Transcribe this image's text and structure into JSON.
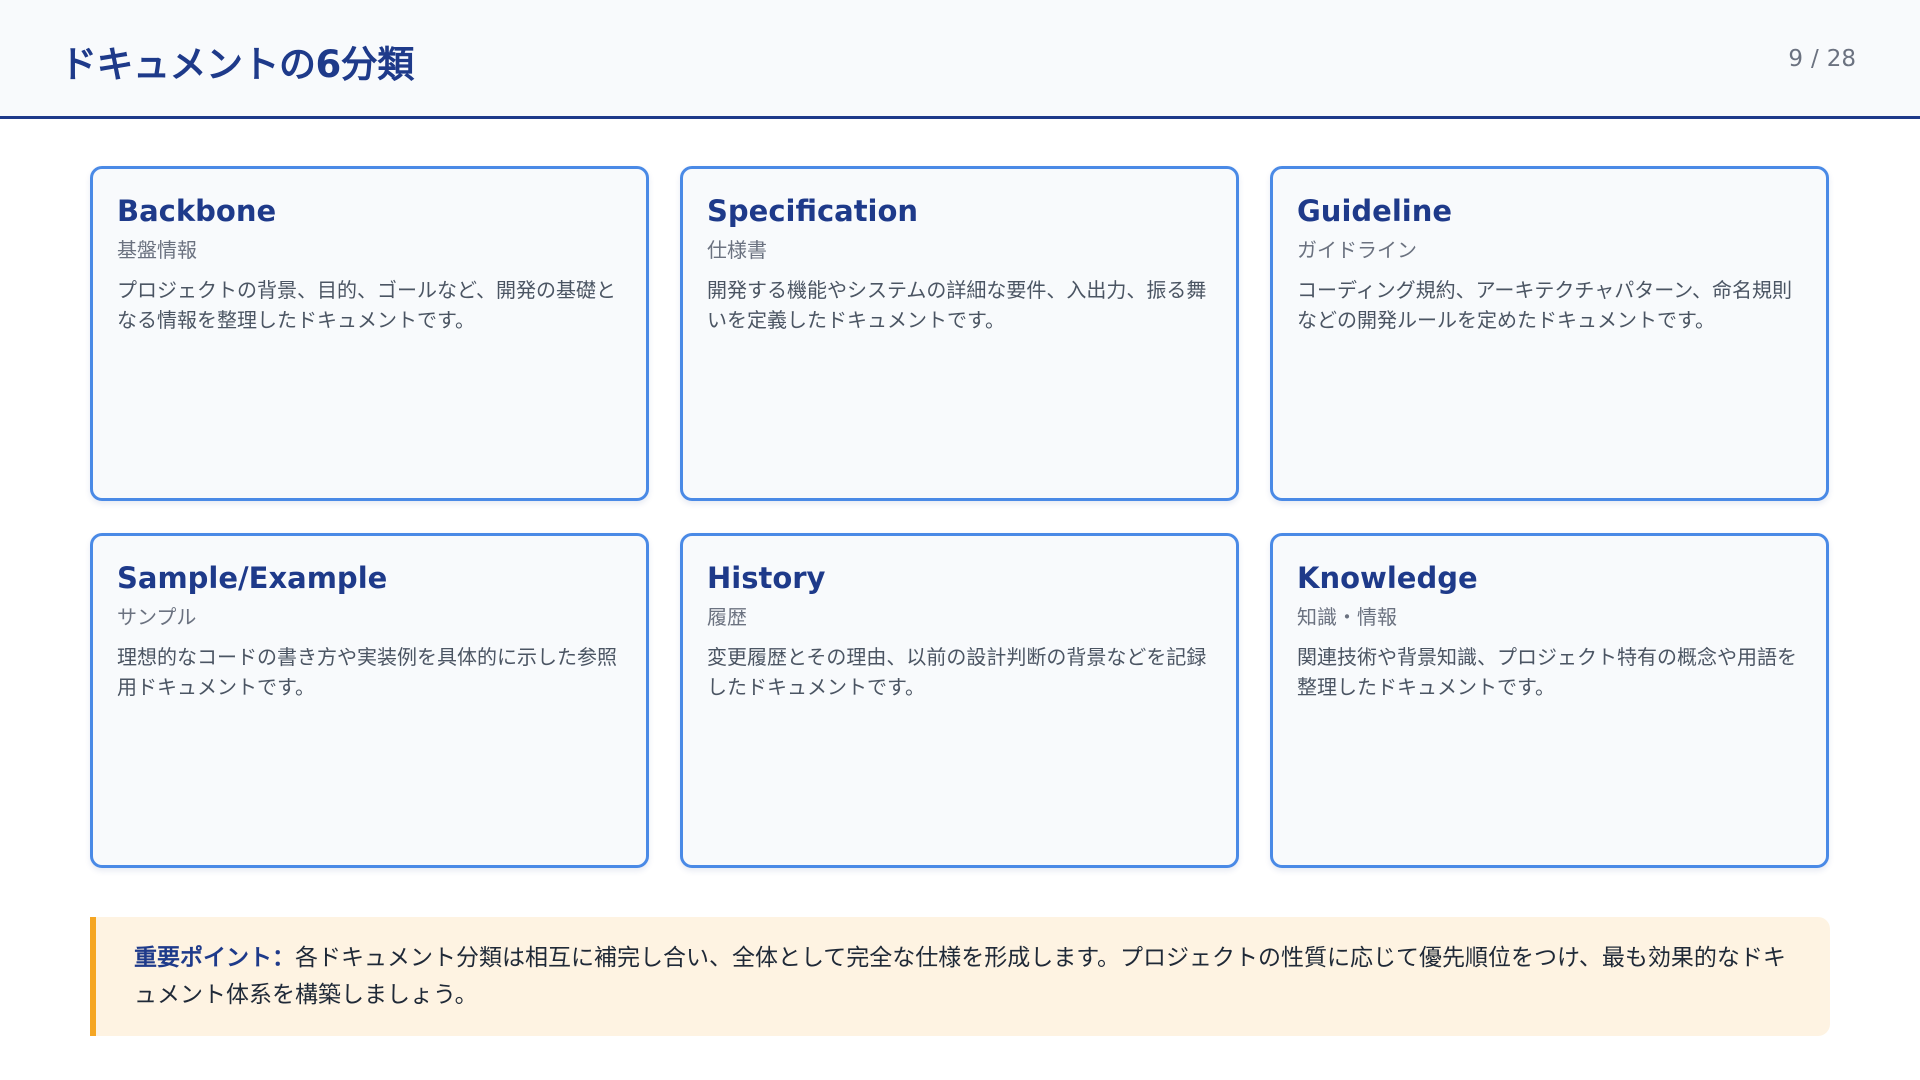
{
  "header": {
    "title": "ドキュメントの6分類",
    "page_current": "9",
    "page_separator": "/",
    "page_total": "28"
  },
  "cards": [
    {
      "title": "Backbone",
      "subtitle": "基盤情報",
      "description": "プロジェクトの背景、目的、ゴールなど、開発の基礎となる情報を整理したドキュメントです。"
    },
    {
      "title": "Specification",
      "subtitle": "仕様書",
      "description": "開発する機能やシステムの詳細な要件、入出力、振る舞いを定義したドキュメントです。"
    },
    {
      "title": "Guideline",
      "subtitle": "ガイドライン",
      "description": "コーディング規約、アーキテクチャパターン、命名規則などの開発ルールを定めたドキュメントです。"
    },
    {
      "title": "Sample/Example",
      "subtitle": "サンプル",
      "description": "理想的なコードの書き方や実装例を具体的に示した参照用ドキュメントです。"
    },
    {
      "title": "History",
      "subtitle": "履歴",
      "description": "変更履歴とその理由、以前の設計判断の背景などを記録したドキュメントです。"
    },
    {
      "title": "Knowledge",
      "subtitle": "知識・情報",
      "description": "関連技術や背景知識、プロジェクト特有の概念や用語を整理したドキュメントです。"
    }
  ],
  "callout": {
    "label": "重要ポイント：",
    "text": "各ドキュメント分類は相互に補完し合い、全体として完全な仕様を形成します。プロジェクトの性質に応じて優先順位をつけ、最も効果的なドキュメント体系を構築しましょう。"
  },
  "colors": {
    "primary": "#1e3a8a",
    "card_border": "#4a8ae6",
    "card_background": "#f8fafc",
    "callout_background": "#fef3e2",
    "callout_accent": "#f5a623"
  }
}
